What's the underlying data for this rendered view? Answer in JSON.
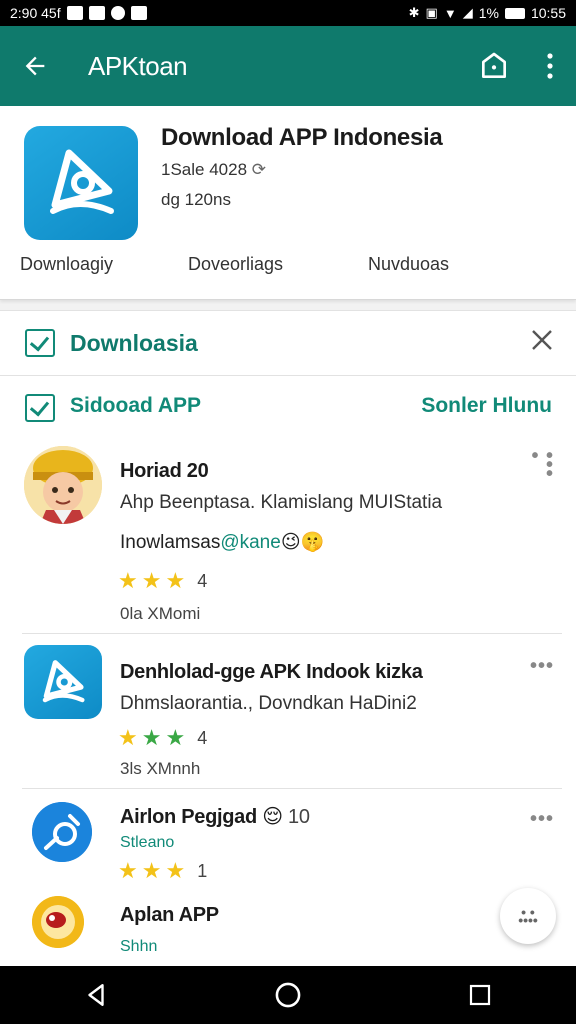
{
  "status_bar": {
    "time": "2:90 45f",
    "battery_text": "1%",
    "clock_right": "10:55"
  },
  "app_bar": {
    "title": "APKtoan",
    "back_icon": "arrow-left-icon",
    "home_icon": "home-icon",
    "more_icon": "more-vert-icon"
  },
  "header": {
    "title": "Download APP Indonesia",
    "meta1": "1Sale 4028",
    "meta2": "dg 120ns",
    "tabs": [
      "Downloagiy",
      "Doveorliags",
      "Nuvduoas"
    ]
  },
  "filter": {
    "label": "Downloasia"
  },
  "list_header": {
    "label": "Sidooad APP",
    "right": "Sonler Hlunu"
  },
  "items": [
    {
      "title": "Horiad 20",
      "desc": "Ahp Beenptasa. Klamislang MUIStatia",
      "sub_text": "Inowlamsas",
      "sub_tag": "@kane",
      "sub_emoji": "😉🤫",
      "rating": "4",
      "size": "0la XMomi"
    },
    {
      "title": "Denhlolad-gge APK Indook kizka",
      "desc": "Dhmslaorantia., Dovndkan HaDini2",
      "rating": "4",
      "size": "3ls XMnnh"
    },
    {
      "title": "Airlon Pegjgad",
      "title_emoji": "😌",
      "title_num": "10",
      "link": "Stleano",
      "rating": "1"
    },
    {
      "title": "Aplan APP",
      "link": "Shhn"
    }
  ],
  "colors": {
    "primary": "#0f7a6c",
    "accent": "#118a78",
    "star": "#f3c219",
    "star_green": "#3aa845"
  }
}
